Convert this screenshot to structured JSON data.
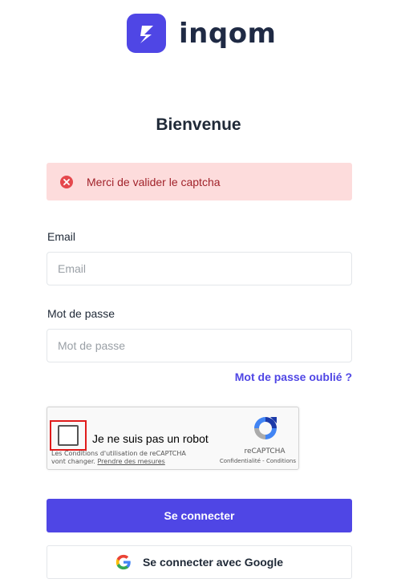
{
  "brand": {
    "name": "inqom",
    "logo_icon": "lightning-bolt-icon",
    "color": "#4f46e5"
  },
  "title": "Bienvenue",
  "alert": {
    "icon": "error-x-icon",
    "message": "Merci de valider le captcha",
    "color": "#e5484d"
  },
  "form": {
    "email_label": "Email",
    "email_placeholder": "Email",
    "email_value": "",
    "password_label": "Mot de passe",
    "password_placeholder": "Mot de passe",
    "password_value": "",
    "forgot_password": "Mot de passe oublié ?"
  },
  "captcha": {
    "checkbox_label": "Je ne suis pas un robot",
    "checked": false,
    "terms_line1": "Les Conditions d'utilisation de reCAPTCHA",
    "terms_line2_prefix": "vont changer.",
    "terms_link": "Prendre des mesures",
    "brand": "reCAPTCHA",
    "privacy": "Confidentialité",
    "separator": "-",
    "conditions": "Conditions",
    "highlight_color": "#e01b1b"
  },
  "buttons": {
    "login": "Se connecter",
    "google": "Se connecter avec Google",
    "google_icon": "google-g-icon"
  }
}
